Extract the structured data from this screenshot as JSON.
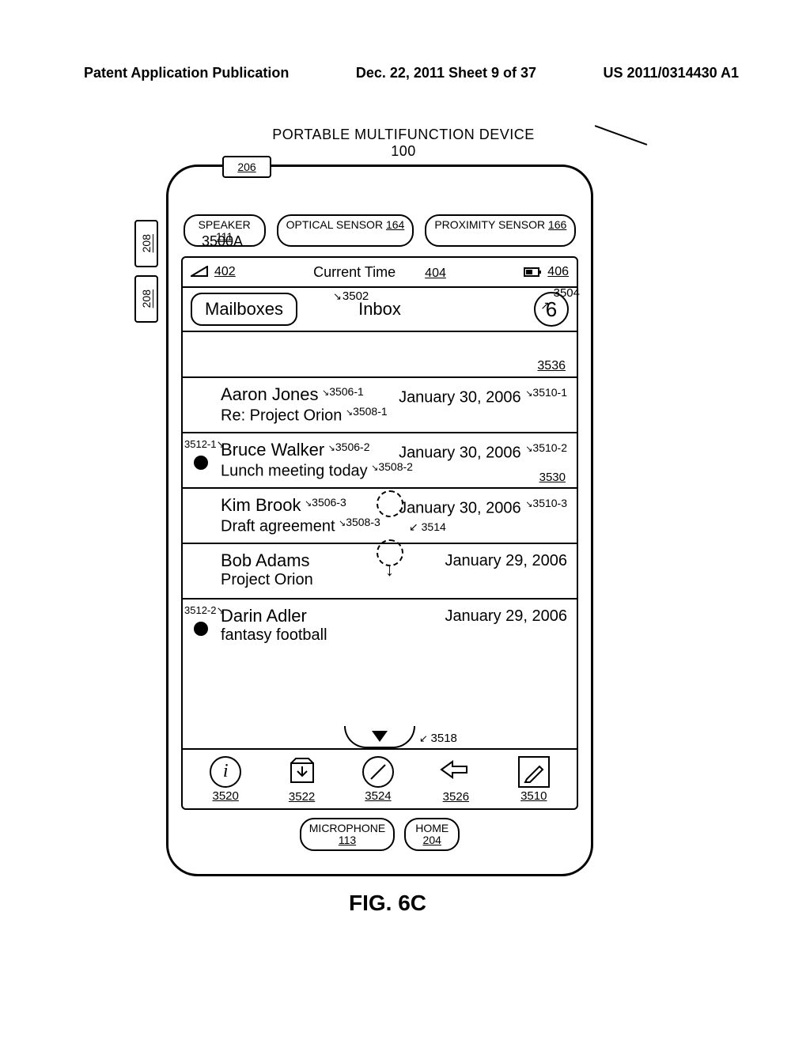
{
  "header": {
    "left": "Patent Application Publication",
    "middle": "Dec. 22, 2011  Sheet 9 of 37",
    "right": "US 2011/0314430 A1"
  },
  "device": {
    "title_top": "PORTABLE MULTIFUNCTION DEVICE",
    "title_num": "100",
    "tab_206": "206",
    "tab_208a": "208",
    "tab_208b": "208",
    "label_3500A": "3500A",
    "ovals": {
      "speaker": {
        "label": "SPEAKER",
        "num": "111"
      },
      "optical": {
        "label": "OPTICAL SENSOR",
        "num": "164"
      },
      "proximity": {
        "label": "PROXIMITY SENSOR",
        "num": "166"
      },
      "microphone": {
        "label": "MICROPHONE",
        "num": "113"
      },
      "home": {
        "label": "HOME",
        "num": "204"
      }
    }
  },
  "status": {
    "ref402": "402",
    "time_label": "Current Time",
    "ref404": "404",
    "ref406": "406"
  },
  "navbar": {
    "mailboxes": "Mailboxes",
    "ref3502": "3502",
    "inbox": "Inbox",
    "count": "6",
    "ref3504": "3504"
  },
  "search": {
    "ref3536": "3536"
  },
  "emails": [
    {
      "sender": "Aaron Jones",
      "sender_ref": "3506-1",
      "subject": "Re: Project Orion",
      "subject_ref": "3508-1",
      "date": "January 30, 2006",
      "date_ref": "3510-1",
      "dot": false
    },
    {
      "sender": "Bruce Walker",
      "sender_ref": "3506-2",
      "subject": "Lunch meeting today",
      "subject_ref": "3508-2",
      "date": "January 30, 2006",
      "date_ref": "3510-2",
      "dot": true,
      "dot_ref": "3512-1",
      "row_ref": "3530"
    },
    {
      "sender": "Kim Brook",
      "sender_ref": "3506-3",
      "subject": "Draft agreement",
      "subject_ref": "3508-3",
      "date": "January 30, 2006",
      "date_ref": "3510-3",
      "dot": false
    },
    {
      "sender": "Bob Adams",
      "sender_ref": "",
      "subject": "Project Orion",
      "subject_ref": "",
      "date": "January 29, 2006",
      "date_ref": "",
      "dot": false
    },
    {
      "sender": "Darin Adler",
      "sender_ref": "",
      "subject": "fantasy football",
      "subject_ref": "",
      "date": "January 29, 2006",
      "date_ref": "",
      "dot": true,
      "dot_ref": "3512-2"
    }
  ],
  "gesture": {
    "ref3514": "3514"
  },
  "more": {
    "ref3518": "3518"
  },
  "toolbar": {
    "info": "3520",
    "inboxmove": "3522",
    "block": "3524",
    "reply": "3526",
    "compose": "3510"
  },
  "figure_label": "FIG. 6C"
}
